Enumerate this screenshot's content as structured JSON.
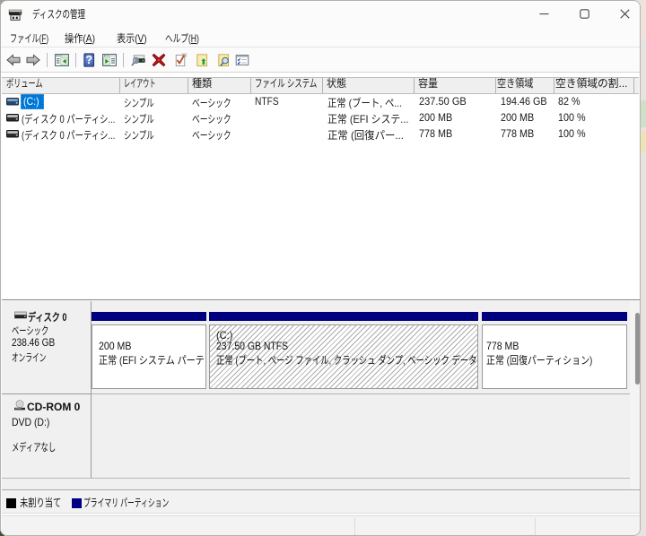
{
  "window": {
    "title": "ディスクの管理",
    "controls": {
      "minimize": "minimize",
      "maximize": "maximize",
      "close": "close"
    }
  },
  "menu": {
    "items": [
      {
        "pre": "ファイル(",
        "key": "F",
        "post": ")"
      },
      {
        "pre": "操作(",
        "key": "A",
        "post": ")"
      },
      {
        "pre": "表示(",
        "key": "V",
        "post": ")"
      },
      {
        "pre": "ヘルプ(",
        "key": "H",
        "post": ")"
      }
    ]
  },
  "toolbar": {
    "icons": [
      "back",
      "forward",
      "show-console-tree",
      "help",
      "show-action-pane",
      "disk-rescan",
      "delete-volume",
      "properties-check",
      "export-list",
      "explore",
      "help-topics"
    ]
  },
  "volume_list": {
    "columns": [
      "ボリューム",
      "レイアウト",
      "種類",
      "ファイル システム",
      "状態",
      "容量",
      "空き領域",
      "空き領域の割..."
    ],
    "rows": [
      {
        "volume": "(C:)",
        "layout": "シンプル",
        "type": "ベーシック",
        "fs": "NTFS",
        "status": "正常 (ブート, ペ...",
        "capacity": "237.50 GB",
        "free": "194.46 GB",
        "pct": "82 %",
        "selected": true
      },
      {
        "volume": "(ディスク 0 パーティシ...",
        "layout": "シンプル",
        "type": "ベーシック",
        "fs": "",
        "status": "正常 (EFI システ...",
        "capacity": "200 MB",
        "free": "200 MB",
        "pct": "100 %",
        "selected": false
      },
      {
        "volume": "(ディスク 0 パーティシ...",
        "layout": "シンプル",
        "type": "ベーシック",
        "fs": "",
        "status": "正常 (回復パー...",
        "capacity": "778 MB",
        "free": "778 MB",
        "pct": "100 %",
        "selected": false
      }
    ]
  },
  "disks": [
    {
      "name": "ディスク 0",
      "type": "ベーシック",
      "size": "238.46 GB",
      "status": "オンライン",
      "partitions": [
        {
          "line1": "200 MB",
          "line2": "正常 (EFI システム パーテ",
          "selected": false
        },
        {
          "label": "(C:)",
          "line1": "237.50 GB NTFS",
          "line2": "正常 (ブート, ページ ファイル, クラッシュ ダンプ, ベーシック データ",
          "selected": true
        },
        {
          "line1": "778 MB",
          "line2": "正常 (回復パーティション)",
          "selected": false
        }
      ]
    },
    {
      "name": "CD-ROM 0",
      "media": "DVD (D:)",
      "status": "メディアなし"
    }
  ],
  "legend": [
    {
      "label": "未割り当て",
      "color": "#000000"
    },
    {
      "label": "プライマリ パーティション",
      "color": "#000080"
    }
  ],
  "colors": {
    "selection": "#0078d7",
    "partition_bar": "#00007e"
  }
}
